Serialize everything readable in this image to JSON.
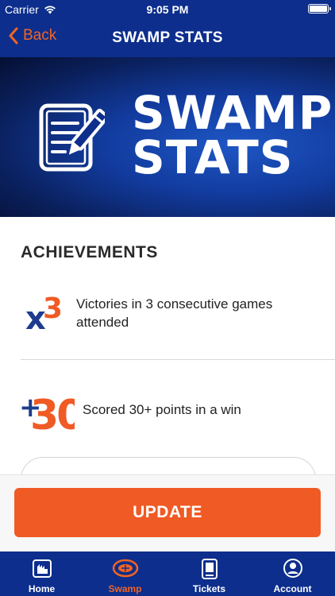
{
  "status_bar": {
    "carrier": "Carrier",
    "time": "9:05 PM"
  },
  "nav": {
    "back_label": "Back",
    "title": "SWAMP STATS"
  },
  "hero": {
    "title_line1": "SWAMP",
    "title_line2": "STATS"
  },
  "achievements": {
    "heading": "ACHIEVEMENTS",
    "items": [
      {
        "badge_main": "x",
        "badge_num": "3",
        "text": "Victories in 3 consecutive games attended"
      },
      {
        "badge_main": "+",
        "badge_num": "30",
        "text": "Scored 30+ points in a win"
      }
    ]
  },
  "update_button": {
    "label": "UPDATE"
  },
  "tabs": [
    {
      "label": "Home",
      "icon": "home-icon"
    },
    {
      "label": "Swamp",
      "icon": "stadium-icon"
    },
    {
      "label": "Tickets",
      "icon": "ticket-icon"
    },
    {
      "label": "Account",
      "icon": "account-icon"
    }
  ],
  "colors": {
    "navy": "#0d2e8c",
    "orange": "#f05a24",
    "badge_blue": "#1d3c8f"
  }
}
